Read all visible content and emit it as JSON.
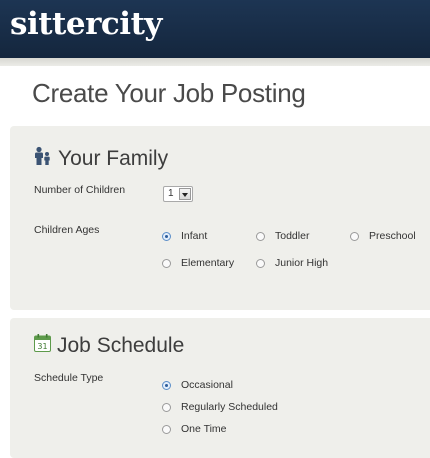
{
  "header": {
    "logo_text": "sittercity",
    "bg_color": "#1b324f"
  },
  "page": {
    "title": "Create Your Job Posting"
  },
  "family": {
    "title": "Your Family",
    "icon": "family-icon",
    "children_label": "Number of Children",
    "children_value": "1",
    "ages_label": "Children Ages",
    "ages_options": [
      {
        "label": "Infant",
        "checked": true
      },
      {
        "label": "Toddler",
        "checked": false
      },
      {
        "label": "Preschool",
        "checked": false
      },
      {
        "label": "Elementary",
        "checked": false
      },
      {
        "label": "Junior High",
        "checked": false
      }
    ]
  },
  "schedule": {
    "title": "Job Schedule",
    "icon": "calendar-icon",
    "calendar_day": "31",
    "type_label": "Schedule Type",
    "type_options": [
      {
        "label": "Occasional",
        "checked": true
      },
      {
        "label": "Regularly Scheduled",
        "checked": false
      },
      {
        "label": "One Time",
        "checked": false
      }
    ]
  }
}
